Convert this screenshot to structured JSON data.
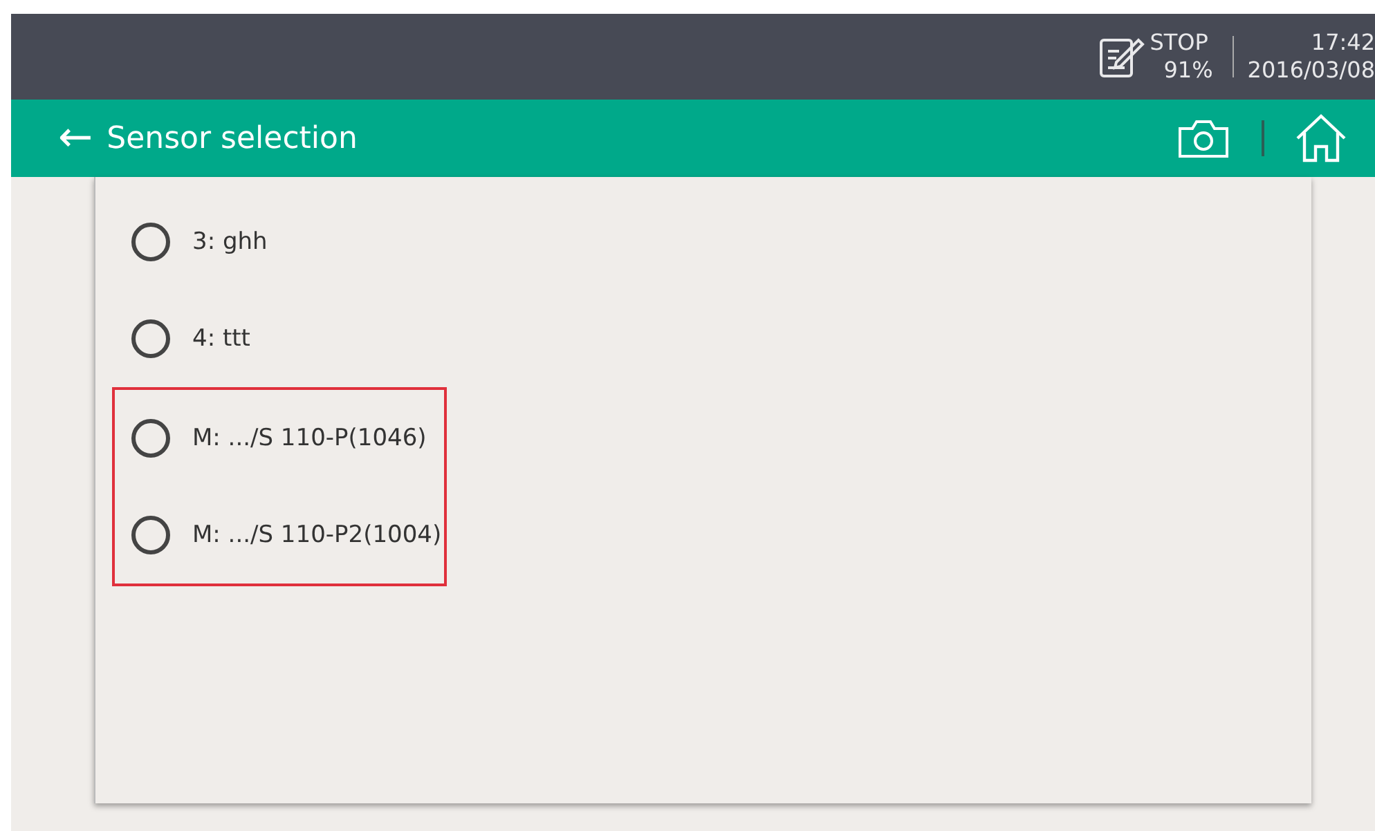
{
  "status_bar": {
    "mode": "STOP",
    "battery": "91%",
    "time": "17:42",
    "date": "2016/03/08"
  },
  "title_bar": {
    "back": "←",
    "title": "Sensor selection"
  },
  "sensors": [
    {
      "label": "3: ghh",
      "selected": false,
      "highlighted": false
    },
    {
      "label": "4: ttt",
      "selected": false,
      "highlighted": false
    },
    {
      "label": "M: .../S 110-P(1046)",
      "selected": false,
      "highlighted": true
    },
    {
      "label": "M: .../S 110-P2(1004)",
      "selected": false,
      "highlighted": true
    }
  ]
}
